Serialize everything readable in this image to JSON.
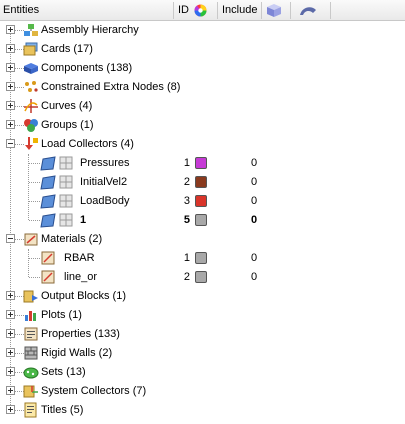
{
  "header": {
    "entities_label": "Entities",
    "id_label": "ID",
    "include_label": "Include",
    "color_icon": "color-wheel-icon",
    "cube_icon": "cube-icon",
    "display_icon": "display-toggle-icon"
  },
  "tree": {
    "assembly_hierarchy": "Assembly Hierarchy",
    "cards": "Cards (17)",
    "components": "Components (138)",
    "constrained_extra_nodes": "Constrained Extra Nodes (8)",
    "curves": "Curves (4)",
    "groups": "Groups (1)",
    "load_collectors": "Load Collectors (4)",
    "load_collector_items": [
      {
        "name": "Pressures",
        "id": "1",
        "include": "0",
        "color": "#c63bd6",
        "bold": false
      },
      {
        "name": "InitialVel2",
        "id": "2",
        "include": "0",
        "color": "#8a3a1e",
        "bold": false
      },
      {
        "name": "LoadBody",
        "id": "3",
        "include": "0",
        "color": "#d9342a",
        "bold": false
      },
      {
        "name": "1",
        "id": "5",
        "include": "0",
        "color": "#a8a8a8",
        "bold": true
      }
    ],
    "materials": "Materials (2)",
    "material_items": [
      {
        "name": "RBAR",
        "id": "1",
        "include": "0",
        "color": "#a8a8a8"
      },
      {
        "name": "line_or",
        "id": "2",
        "include": "0",
        "color": "#a8a8a8"
      }
    ],
    "output_blocks": "Output Blocks (1)",
    "plots": "Plots (1)",
    "properties": "Properties (133)",
    "rigid_walls": "Rigid Walls (2)",
    "sets": "Sets (13)",
    "system_collectors": "System Collectors (7)",
    "titles": "Titles (5)"
  }
}
